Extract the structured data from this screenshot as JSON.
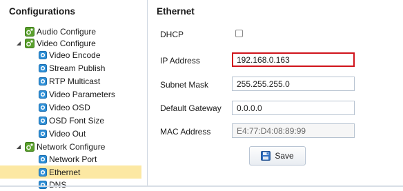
{
  "left_panel": {
    "title": "Configurations",
    "items": [
      {
        "label": "Audio Configure"
      },
      {
        "label": "Video Configure"
      },
      {
        "label": "Video Encode"
      },
      {
        "label": "Stream Publish"
      },
      {
        "label": "RTP Multicast"
      },
      {
        "label": "Video Parameters"
      },
      {
        "label": "Video OSD"
      },
      {
        "label": "OSD Font Size"
      },
      {
        "label": "Video Out"
      },
      {
        "label": "Network Configure"
      },
      {
        "label": "Network Port"
      },
      {
        "label": "Ethernet"
      },
      {
        "label": "DNS"
      }
    ]
  },
  "main": {
    "title": "Ethernet",
    "fields": {
      "dhcp": {
        "label": "DHCP",
        "checked": false
      },
      "ip": {
        "label": "IP Address",
        "value": "192.168.0.163"
      },
      "subnet": {
        "label": "Subnet Mask",
        "value": "255.255.255.0"
      },
      "gateway": {
        "label": "Default Gateway",
        "value": "0.0.0.0"
      },
      "mac": {
        "label": "MAC Address",
        "value": "E4:77:D4:08:89:99"
      }
    },
    "save_label": "Save"
  },
  "colors": {
    "selection": "#fce8a3",
    "highlight_border": "#d0131b",
    "node_icon": "#2e8fd6",
    "group_icon": "#5aa02c"
  }
}
